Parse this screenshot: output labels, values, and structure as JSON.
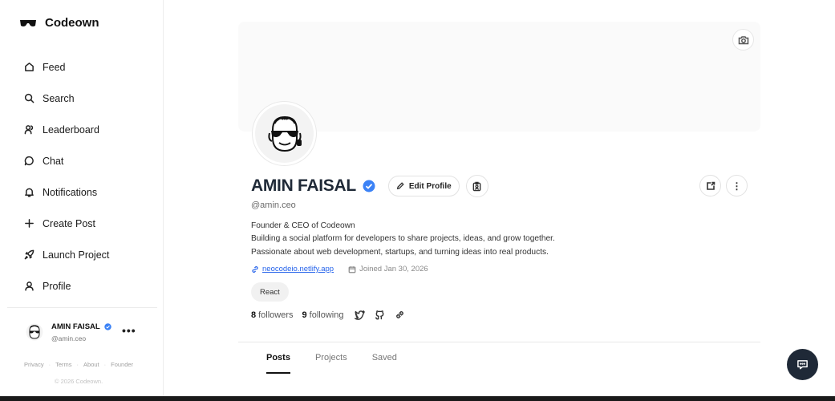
{
  "brand": {
    "name": "Codeown",
    "logo_icon": "sunglasses-logo-icon"
  },
  "nav": {
    "items": [
      {
        "label": "Feed",
        "icon": "home-icon"
      },
      {
        "label": "Search",
        "icon": "search-icon"
      },
      {
        "label": "Leaderboard",
        "icon": "users-icon"
      },
      {
        "label": "Chat",
        "icon": "chat-icon"
      },
      {
        "label": "Notifications",
        "icon": "bell-icon"
      },
      {
        "label": "Create Post",
        "icon": "plus-icon"
      },
      {
        "label": "Launch Project",
        "icon": "rocket-icon"
      },
      {
        "label": "Profile",
        "icon": "user-icon"
      }
    ]
  },
  "user_card": {
    "name": "AMIN FAISAL",
    "handle": "@amin.ceo",
    "more": "•••"
  },
  "footer": {
    "links": [
      "Privacy",
      "Terms",
      "About",
      "Founder"
    ],
    "separator": "·",
    "copyright": "© 2026 Codeown."
  },
  "profile": {
    "display_name": "AMIN FAISAL",
    "handle": "@amin.ceo",
    "edit_label": "Edit Profile",
    "bio": [
      "Founder & CEO of Codeown",
      "Building a social platform for developers to share projects, ideas, and grow together.",
      "Passionate about web development, startups, and turning ideas into real products."
    ],
    "website": "neocodeio.netlify.app",
    "joined": "Joined Jan 30, 2026",
    "tag": "React",
    "followers_count": "8",
    "followers_label": "followers",
    "following_count": "9",
    "following_label": "following",
    "menu_label": "⋮"
  },
  "tabs": [
    {
      "label": "Posts",
      "active": true
    },
    {
      "label": "Projects",
      "active": false
    },
    {
      "label": "Saved",
      "active": false
    }
  ],
  "colors": {
    "accent": "#2563eb",
    "verified": "#3b82f6",
    "fab": "#1f2937"
  }
}
